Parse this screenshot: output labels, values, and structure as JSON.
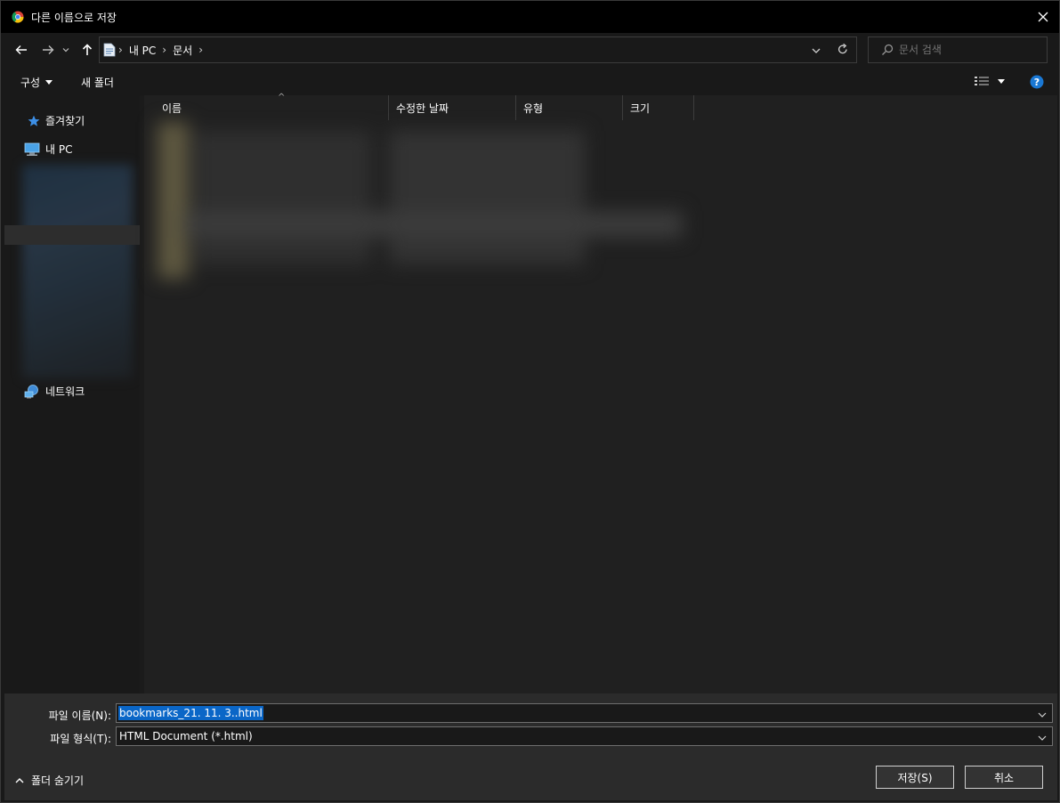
{
  "window": {
    "title": "다른 이름으로 저장"
  },
  "nav": {
    "breadcrumbs": [
      "내 PC",
      "문서"
    ],
    "search_placeholder": "문서 검색"
  },
  "toolbar": {
    "organize_label": "구성",
    "new_folder_label": "새 폴더"
  },
  "sidebar": {
    "items": [
      {
        "label": "즐겨찾기",
        "icon": "star-icon"
      },
      {
        "label": "내 PC",
        "icon": "computer-icon"
      },
      {
        "label": "네트워크",
        "icon": "network-icon"
      }
    ]
  },
  "columns": [
    "이름",
    "수정한 날짜",
    "유형",
    "크기"
  ],
  "form": {
    "filename_label": "파일 이름(N):",
    "filename_value": "bookmarks_21. 11. 3..html",
    "filetype_label": "파일 형식(T):",
    "filetype_value": "HTML Document (*.html)"
  },
  "footer": {
    "hide_folders_label": "폴더 숨기기",
    "save_label": "저장(S)",
    "cancel_label": "취소"
  },
  "colors": {
    "titlebar": "#000000",
    "background": "#191919",
    "selection": "#0a66c7",
    "help": "#1a78d4"
  }
}
